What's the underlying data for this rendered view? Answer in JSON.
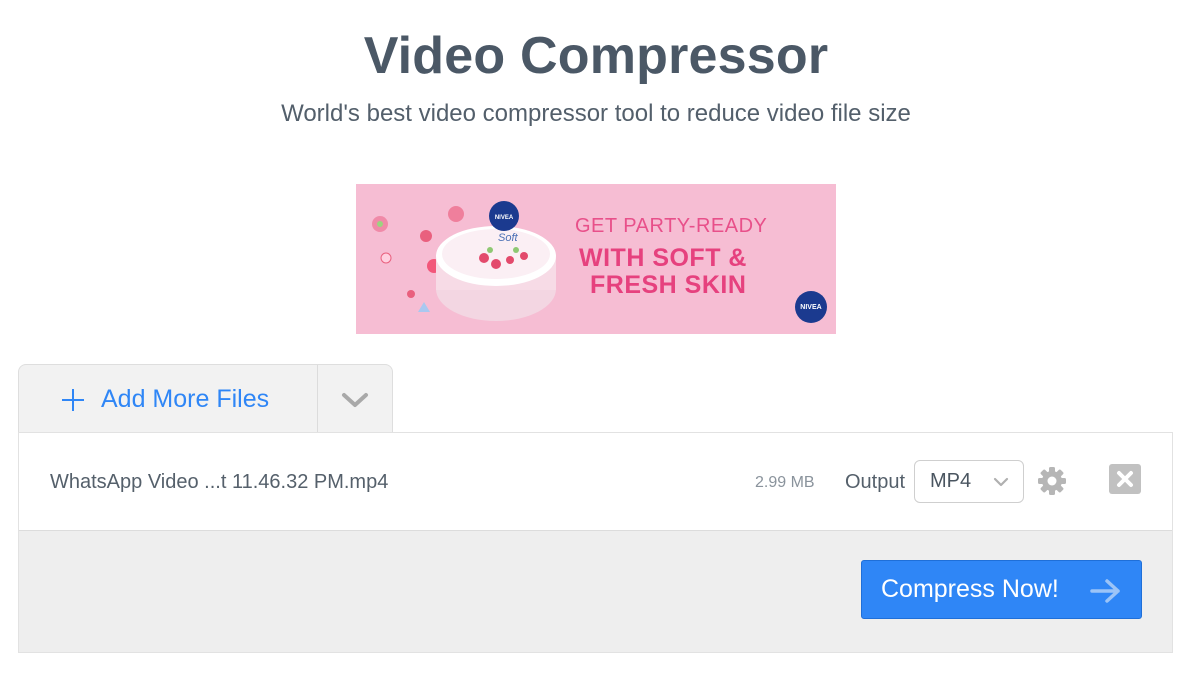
{
  "header": {
    "title": "Video Compressor",
    "subtitle": "World's best video compressor tool to reduce video file size"
  },
  "ad": {
    "line1": "GET PARTY-READY",
    "line2": "WITH SOFT &",
    "line3": "FRESH SKIN",
    "brand": "NIVEA",
    "product_label": "Soft"
  },
  "toolbar": {
    "add_files_label": "Add More Files"
  },
  "file": {
    "name": "WhatsApp Video ...t 11.46.32 PM.mp4",
    "size": "2.99 MB",
    "output_label": "Output",
    "format": "MP4"
  },
  "actions": {
    "compress_label": "Compress Now!"
  },
  "colors": {
    "accent": "#2f86f6",
    "ad_background": "#f6bdd3",
    "ad_text": "#e6417e",
    "title": "#4b5866"
  },
  "icons": [
    "plus-icon",
    "chevron-down-icon",
    "gear-icon",
    "close-icon",
    "arrow-right-icon"
  ]
}
